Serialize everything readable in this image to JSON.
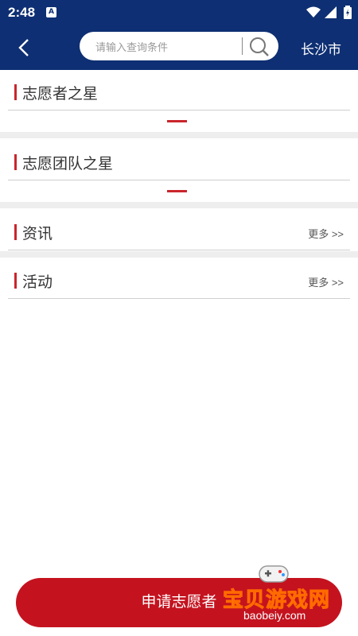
{
  "status_bar": {
    "time": "2:48",
    "notification_icon": "A"
  },
  "header": {
    "back_icon": "chevron-left-icon",
    "search_placeholder": "请输入查询条件",
    "search_icon": "search-icon",
    "city": "长沙市"
  },
  "sections": [
    {
      "title": "志愿者之星"
    },
    {
      "title": "志愿团队之星"
    },
    {
      "title": "资讯",
      "more": "更多 >>"
    },
    {
      "title": "活动",
      "more": "更多 >>"
    }
  ],
  "apply_button": {
    "label": "申请志愿者"
  },
  "watermark": {
    "title": "宝贝游戏网",
    "url": "baobeiy.com"
  },
  "colors": {
    "header_bg": "#0e2f73",
    "accent": "#c9252b",
    "button_bg": "#c4131f"
  }
}
